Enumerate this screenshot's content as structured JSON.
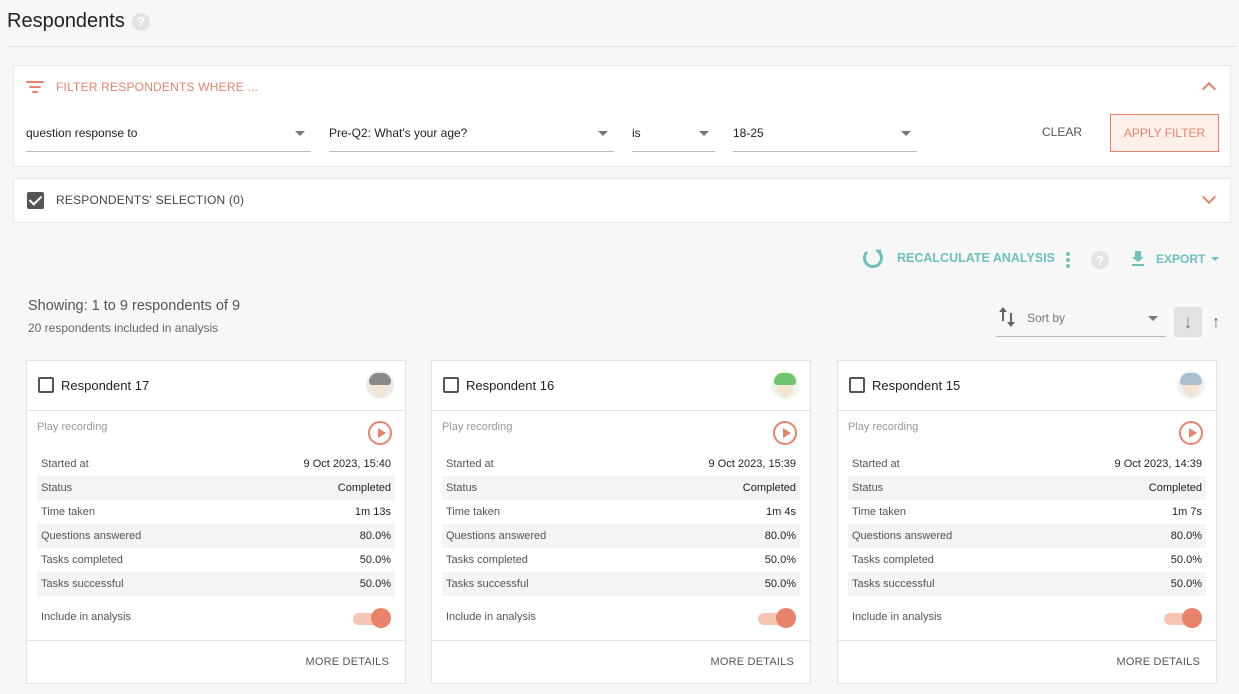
{
  "header": {
    "title": "Respondents",
    "help": "?"
  },
  "filter": {
    "heading": "FILTER RESPONDENTS WHERE ...",
    "field": "question response to",
    "question": "Pre-Q2: What's your age?",
    "operator": "is",
    "value": "18-25",
    "clear_label": "CLEAR",
    "apply_label": "APPLY FILTER"
  },
  "selection": {
    "label": "RESPONDENTS' SELECTION (0)",
    "checked": true
  },
  "actions": {
    "recalc_label": "RECALCULATE ANALYSIS",
    "help": "?",
    "export_label": "EXPORT"
  },
  "summary": {
    "showing": "Showing: 1 to 9 respondents of 9",
    "included": "20 respondents included in analysis"
  },
  "sort": {
    "placeholder": "Sort by"
  },
  "labels": {
    "play": "Play recording",
    "started": "Started at",
    "status": "Status",
    "time": "Time taken",
    "questions": "Questions answered",
    "tasks_completed": "Tasks completed",
    "tasks_successful": "Tasks successful",
    "include": "Include in analysis",
    "more": "MORE DETAILS"
  },
  "cards": [
    {
      "name": "Respondent 17",
      "started": "9 Oct 2023, 15:40",
      "status": "Completed",
      "time": "1m 13s",
      "questions": "80.0%",
      "tasks_completed": "50.0%",
      "tasks_successful": "50.0%",
      "included": true,
      "avatar_hair": "#8a8a8a",
      "avatar_bg": "#ececec"
    },
    {
      "name": "Respondent 16",
      "started": "9 Oct 2023, 15:39",
      "status": "Completed",
      "time": "1m 4s",
      "questions": "80.0%",
      "tasks_completed": "50.0%",
      "tasks_successful": "50.0%",
      "included": true,
      "avatar_hair": "#6fc56f",
      "avatar_bg": "#eaf6ea"
    },
    {
      "name": "Respondent 15",
      "started": "9 Oct 2023, 14:39",
      "status": "Completed",
      "time": "1m 7s",
      "questions": "80.0%",
      "tasks_completed": "50.0%",
      "tasks_successful": "50.0%",
      "included": true,
      "avatar_hair": "#a9bfcf",
      "avatar_bg": "#eef2f5"
    }
  ],
  "colors": {
    "accent": "#e8836a",
    "teal": "#6cc1bd"
  }
}
